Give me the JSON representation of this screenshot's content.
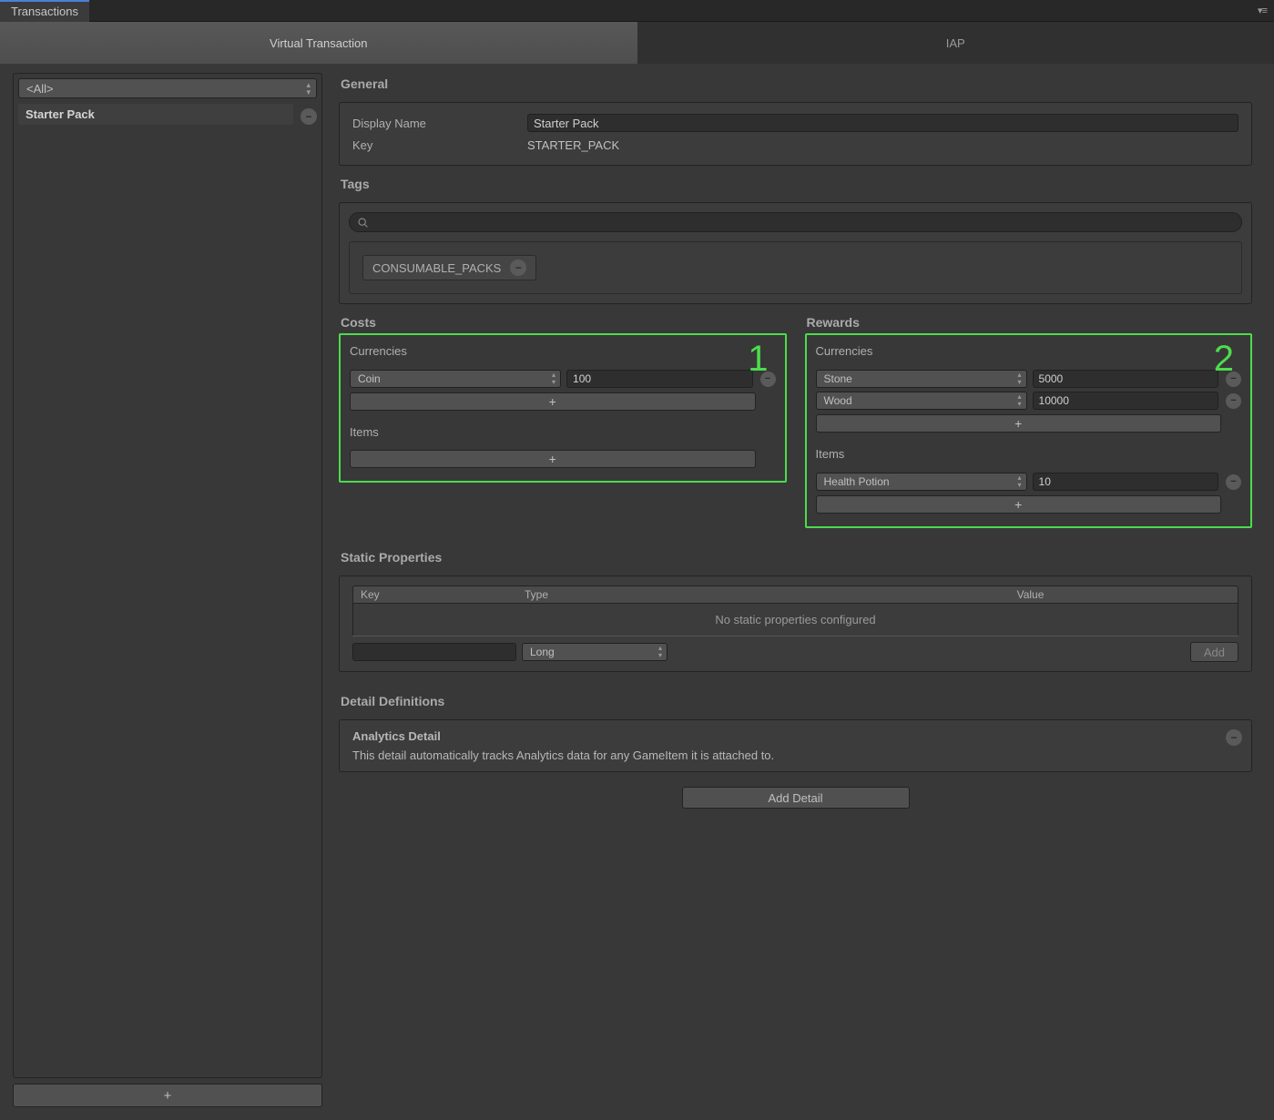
{
  "window": {
    "title": "Transactions"
  },
  "subtabs": {
    "virtual": "Virtual Transaction",
    "iap": "IAP"
  },
  "sidebar": {
    "filter": "<All>",
    "items": [
      {
        "name": "Starter Pack"
      }
    ],
    "add_label": "+"
  },
  "general": {
    "heading": "General",
    "display_name_label": "Display Name",
    "display_name": "Starter Pack",
    "key_label": "Key",
    "key": "STARTER_PACK"
  },
  "tags": {
    "heading": "Tags",
    "search_placeholder": "",
    "items": [
      "CONSUMABLE_PACKS"
    ]
  },
  "costs": {
    "heading": "Costs",
    "annotation": "1",
    "currencies_label": "Currencies",
    "currencies": [
      {
        "name": "Coin",
        "amount": "100"
      }
    ],
    "items_label": "Items",
    "items": []
  },
  "rewards": {
    "heading": "Rewards",
    "annotation": "2",
    "currencies_label": "Currencies",
    "currencies": [
      {
        "name": "Stone",
        "amount": "5000"
      },
      {
        "name": "Wood",
        "amount": "10000"
      }
    ],
    "items_label": "Items",
    "items": [
      {
        "name": "Health Potion",
        "amount": "10"
      }
    ]
  },
  "static_props": {
    "heading": "Static Properties",
    "col_key": "Key",
    "col_type": "Type",
    "col_value": "Value",
    "empty": "No static properties configured",
    "new_type": "Long",
    "add_label": "Add"
  },
  "detail_defs": {
    "heading": "Detail Definitions",
    "analytics_title": "Analytics Detail",
    "analytics_desc": "This detail automatically tracks Analytics data for any GameItem it is attached to.",
    "add_detail_label": "Add Detail"
  }
}
